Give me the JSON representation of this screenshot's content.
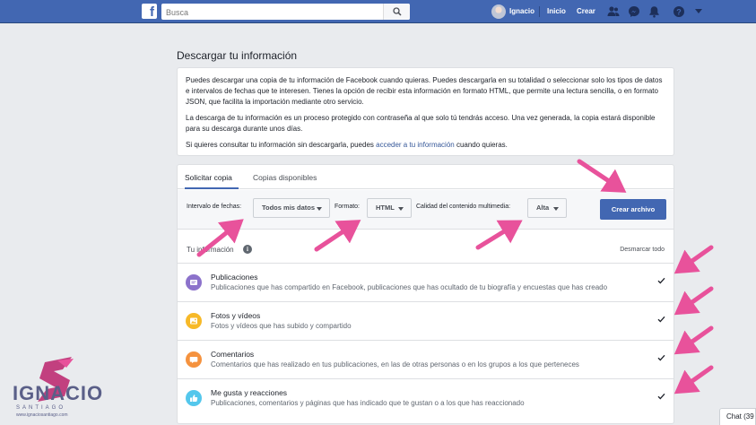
{
  "topbar": {
    "logo": "f",
    "search_placeholder": "Busca",
    "user_name": "Ignacio",
    "nav_home": "Inicio",
    "nav_create": "Crear",
    "icons": [
      "friends-icon",
      "messenger-icon",
      "notifications-icon",
      "help-icon",
      "menu-caret-icon"
    ]
  },
  "page": {
    "title": "Descargar tu información"
  },
  "info": {
    "p1": "Puedes descargar una copia de tu información de Facebook cuando quieras. Puedes descargarla en su totalidad o seleccionar solo los tipos de datos e intervalos de fechas que te interesen. Tienes la opción de recibir esta información en formato HTML, que permite una lectura sencilla, o en formato JSON, que facilita la importación mediante otro servicio.",
    "p2": "La descarga de tu información es un proceso protegido con contraseña al que solo tú tendrás acceso. Una vez generada, la copia estará disponible para su descarga durante unos días.",
    "p3_pre": "Si quieres consultar tu información sin descargarla, puedes ",
    "p3_link": "acceder a tu información",
    "p3_post": " cuando quieras."
  },
  "tabs": [
    {
      "label": "Solicitar copia",
      "active": true
    },
    {
      "label": "Copias disponibles",
      "active": false
    }
  ],
  "filters": {
    "date_label": "Intervalo de fechas:",
    "date_value": "Todos mis datos",
    "format_label": "Formato:",
    "format_value": "HTML",
    "quality_label": "Calidad del contenido multimedia:",
    "quality_value": "Alta",
    "create_button": "Crear archivo"
  },
  "your_info": {
    "label": "Tu información",
    "deselect_all": "Desmarcar todo",
    "categories": [
      {
        "title": "Publicaciones",
        "desc": "Publicaciones que has compartido en Facebook, publicaciones que has ocultado de tu biografía y encuestas que has creado",
        "checked": true,
        "icon": "posts-icon",
        "color": "#8c72cb"
      },
      {
        "title": "Fotos y vídeos",
        "desc": "Fotos y vídeos que has subido y compartido",
        "checked": true,
        "icon": "photos-icon",
        "color": "#f7b928"
      },
      {
        "title": "Comentarios",
        "desc": "Comentarios que has realizado en tus publicaciones, en las de otras personas o en los grupos a los que perteneces",
        "checked": true,
        "icon": "comments-icon",
        "color": "#f5923e"
      },
      {
        "title": "Me gusta y reacciones",
        "desc": "Publicaciones, comentarios y páginas que has indicado que te gustan o a los que has reaccionado",
        "checked": true,
        "icon": "like-icon",
        "color": "#54c7ec"
      }
    ]
  },
  "watermark": {
    "name": "IGNACIO",
    "sub": "SANTIAGO",
    "url": "www.ignaciosantiago.com"
  },
  "chat": {
    "label": "Chat (39"
  },
  "colors": {
    "brand_blue": "#4267b2",
    "arrow_pink": "#e8529b",
    "background": "#e9ebee"
  }
}
